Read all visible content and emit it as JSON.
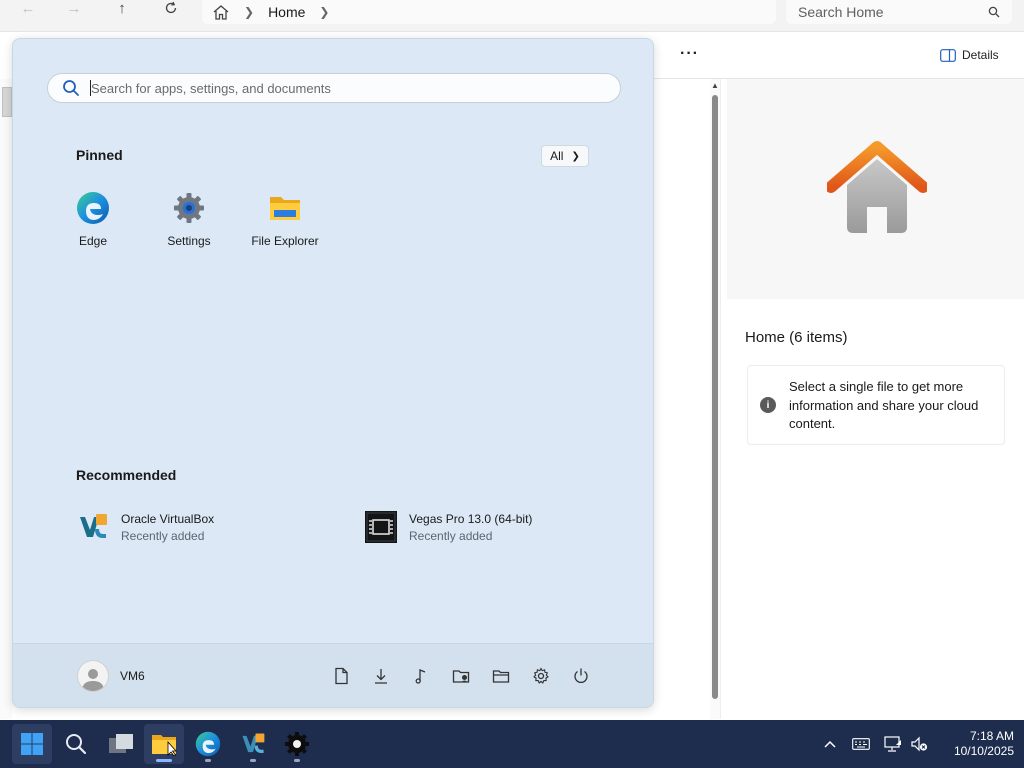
{
  "explorer": {
    "breadcrumb": "Home",
    "search_placeholder": "Search Home",
    "more_label": "···",
    "details_label": "Details",
    "details_title": "Home (6 items)",
    "info_text": "Select a single file to get more information and share your cloud content."
  },
  "start": {
    "search_placeholder": "Search for apps, settings, and documents",
    "pinned_title": "Pinned",
    "all_label": "All",
    "pinned": [
      {
        "label": "Edge",
        "icon": "edge-icon"
      },
      {
        "label": "Settings",
        "icon": "gear-icon"
      },
      {
        "label": "File Explorer",
        "icon": "folder-icon"
      }
    ],
    "recommended_title": "Recommended",
    "recommended": [
      {
        "name": "Oracle VirtualBox",
        "sub": "Recently added",
        "icon": "virtualbox-icon"
      },
      {
        "name": "Vegas Pro 13.0 (64-bit)",
        "sub": "Recently added",
        "icon": "vegas-icon"
      }
    ],
    "user": "VM6",
    "footer_icons": [
      "documents-icon",
      "downloads-icon",
      "music-icon",
      "network-folder-icon",
      "personal-folder-icon",
      "settings-icon",
      "power-icon"
    ]
  },
  "taskbar": {
    "items": [
      "start-icon",
      "search-icon",
      "task-view-icon",
      "file-explorer-icon",
      "edge-icon",
      "virtualbox-icon",
      "settings-icon"
    ],
    "time": "7:18 AM",
    "date": "10/10/2025"
  }
}
